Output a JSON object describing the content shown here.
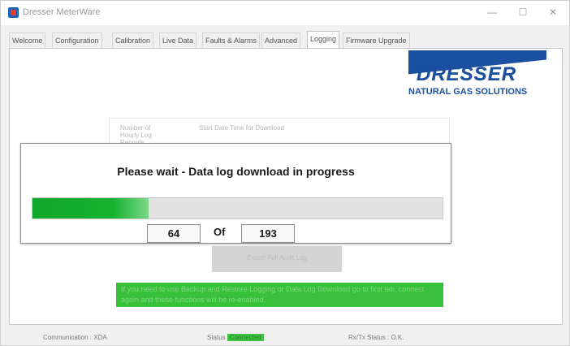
{
  "window": {
    "title": "Dresser MeterWare"
  },
  "tabs": [
    "Welcome",
    "Configuration",
    "Calibration",
    "Live Data",
    "Faults & Alarms",
    "Advanced",
    "Logging",
    "Firmware Upgrade"
  ],
  "active_tab": "Logging",
  "logo": {
    "word": "DRESSER",
    "sub": "NATURAL GAS SOLUTIONS",
    "brand_color": "#1b4fa0"
  },
  "background_panel": {
    "label_records": "Number of Hourly Log Records",
    "label_start": "Start Date Time for Download",
    "button": "Export Full Audit Log",
    "warning": "If you need to use Backup and Restore Logging or Data Log Download go to first tab, connect again and these functions will be re-enabled."
  },
  "dialog": {
    "message": "Please wait - Data log download in progress",
    "current": "64",
    "of_label": "Of",
    "total": "193",
    "progress_fraction": 0.283,
    "progress_color": "#17b230"
  },
  "statusbar": {
    "communication": "Communication : XDA",
    "status_label": "Status",
    "status_value": "Connected",
    "rxtx": "Rx/Tx Status : O.K."
  }
}
